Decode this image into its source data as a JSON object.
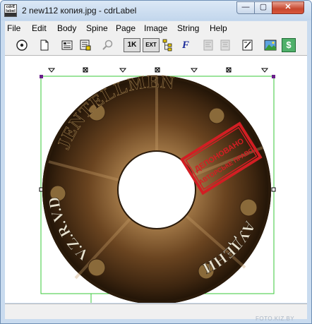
{
  "window": {
    "title": "2 new112 копия.jpg - cdrLabel",
    "app_icon_text_top": "cdrE",
    "app_icon_text_mid": "label",
    "minimize_symbol": "—",
    "maximize_symbol": "▢",
    "close_symbol": "✕"
  },
  "menu": {
    "items": [
      "File",
      "Edit",
      "Body",
      "Spine",
      "Page",
      "Image",
      "String",
      "Help"
    ]
  },
  "toolbar": {
    "tools": [
      {
        "name": "disc-icon"
      },
      {
        "name": "new-page-icon"
      },
      {
        "name": "image-list-icon"
      },
      {
        "name": "text-list-icon"
      },
      {
        "name": "magnifier-icon"
      },
      {
        "name": "1k-button",
        "label": "1K"
      },
      {
        "name": "ext-button",
        "label": "EXT"
      },
      {
        "name": "tree-icon"
      },
      {
        "name": "font-icon",
        "label": "F"
      },
      {
        "name": "align-left-icon"
      },
      {
        "name": "align-center-icon"
      },
      {
        "name": "edit-icon"
      },
      {
        "name": "picture-icon"
      },
      {
        "name": "dollar-icon",
        "label": "$"
      }
    ]
  },
  "label": {
    "top_text": "JENTELLMEN",
    "left_text": "V.Z.R.V.D",
    "bottom_text": "АУДЕНИ",
    "stamp_text_top": "ДЕПОНОВАНО",
    "stamp_text_main": "АВТОРСЬКЕ ПРАВО"
  },
  "watermark": "FOTO.KIZ.BY",
  "colors": {
    "title_bg": "#c9dbef",
    "selection_green": "#3ac93a",
    "disc_brown": "#5a3b1c",
    "stamp_red": "#d21e23"
  }
}
